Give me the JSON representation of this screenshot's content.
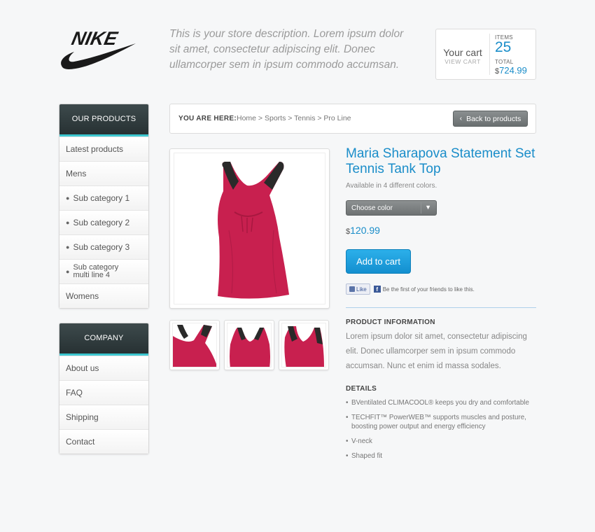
{
  "brand": {
    "logo_text": "NIKE"
  },
  "header": {
    "store_description": "This is your store description. Lorem ipsum dolor sit amet, consectetur adipiscing elit. Donec ullamcorper sem in ipsum commodo accumsan."
  },
  "cart": {
    "title": "Your cart",
    "view_link": "VIEW CART",
    "items_label": "ITEMS",
    "items_count": "25",
    "total_label": "TOTAL",
    "currency": "$",
    "total_value": "724.99"
  },
  "sidebar": {
    "products": {
      "header": "OUR PRODUCTS",
      "items": [
        {
          "label": "Latest products"
        },
        {
          "label": "Mens"
        },
        {
          "label": "Sub category 1"
        },
        {
          "label": "Sub category 2"
        },
        {
          "label": "Sub category 3"
        },
        {
          "label": "Sub category multi line 4"
        },
        {
          "label": "Womens"
        }
      ]
    },
    "company": {
      "header": "COMPANY",
      "items": [
        {
          "label": "About us"
        },
        {
          "label": "FAQ"
        },
        {
          "label": "Shipping"
        },
        {
          "label": "Contact"
        }
      ]
    }
  },
  "breadcrumb": {
    "label": "YOU ARE HERE:",
    "path": "Home > Sports > Tennis > Pro Line",
    "back_button": "Back to products"
  },
  "product": {
    "title": "Maria Sharapova Statement Set Tennis Tank Top",
    "availability": "Available in 4 different colors.",
    "color_select": "Choose color",
    "currency": "$",
    "price": "120.99",
    "add_to_cart": "Add to cart",
    "like_button": "Like",
    "like_text": "Be the first of your friends to like this.",
    "info_title": "PRODUCT INFORMATION",
    "info_body": "Lorem ipsum dolor sit amet, consectetur adipiscing elit. Donec ullamcorper sem in ipsum commodo accumsan. Nunc et enim id massa sodales.",
    "details_title": "DETAILS",
    "details": [
      "BVentilated CLIMACOOL® keeps you dry and comfortable",
      "TECHFIT™ PowerWEB™ supports muscles and posture, boosting power output and energy efficiency",
      "V-neck",
      "Shaped fit"
    ]
  },
  "colors": {
    "accent": "#1a8dc9",
    "sidebar_header": "#2f3a3c",
    "sidebar_stripe": "#3cc7d0",
    "product_pink": "#c8204f"
  }
}
